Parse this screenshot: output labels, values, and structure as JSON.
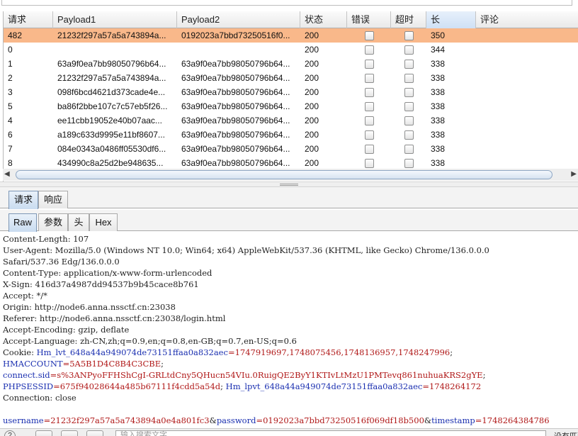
{
  "table": {
    "columns": [
      "请求",
      "Payload1",
      "Payload2",
      "状态",
      "错误",
      "超时",
      "长",
      "评论"
    ],
    "sorted_column": "长",
    "sort_icon": "sort-descending-icon",
    "rows": [
      {
        "req": "482",
        "p1": "21232f297a57a5a743894a...",
        "p2": "0192023a7bbd73250516f0...",
        "status": "200",
        "error": false,
        "timeout": false,
        "length": "350",
        "comment": "",
        "selected": true
      },
      {
        "req": "0",
        "p1": "",
        "p2": "",
        "status": "200",
        "error": false,
        "timeout": false,
        "length": "344",
        "comment": "",
        "selected": false
      },
      {
        "req": "1",
        "p1": "63a9f0ea7bb98050796b64...",
        "p2": "63a9f0ea7bb98050796b64...",
        "status": "200",
        "error": false,
        "timeout": false,
        "length": "338",
        "comment": "",
        "selected": false
      },
      {
        "req": "2",
        "p1": "21232f297a57a5a743894a...",
        "p2": "63a9f0ea7bb98050796b64...",
        "status": "200",
        "error": false,
        "timeout": false,
        "length": "338",
        "comment": "",
        "selected": false
      },
      {
        "req": "3",
        "p1": "098f6bcd4621d373cade4e...",
        "p2": "63a9f0ea7bb98050796b64...",
        "status": "200",
        "error": false,
        "timeout": false,
        "length": "338",
        "comment": "",
        "selected": false
      },
      {
        "req": "5",
        "p1": "ba86f2bbe107c7c57eb5f26...",
        "p2": "63a9f0ea7bb98050796b64...",
        "status": "200",
        "error": false,
        "timeout": false,
        "length": "338",
        "comment": "",
        "selected": false
      },
      {
        "req": "4",
        "p1": "ee11cbb19052e40b07aac...",
        "p2": "63a9f0ea7bb98050796b64...",
        "status": "200",
        "error": false,
        "timeout": false,
        "length": "338",
        "comment": "",
        "selected": false
      },
      {
        "req": "6",
        "p1": "a189c633d9995e11bf8607...",
        "p2": "63a9f0ea7bb98050796b64...",
        "status": "200",
        "error": false,
        "timeout": false,
        "length": "338",
        "comment": "",
        "selected": false
      },
      {
        "req": "7",
        "p1": "084e0343a0486ff05530df6...",
        "p2": "63a9f0ea7bb98050796b64...",
        "status": "200",
        "error": false,
        "timeout": false,
        "length": "338",
        "comment": "",
        "selected": false
      },
      {
        "req": "8",
        "p1": "434990c8a25d2be948635...",
        "p2": "63a9f0ea7bb98050796b64...",
        "status": "200",
        "error": false,
        "timeout": false,
        "length": "338",
        "comment": "",
        "selected": false
      }
    ]
  },
  "main_tabs": {
    "request": "请求",
    "response": "响应",
    "active": "request"
  },
  "sub_tabs": {
    "raw": "Raw",
    "params": "参数",
    "headers": "头",
    "hex": "Hex",
    "active": "raw"
  },
  "raw_request": {
    "lines": [
      [
        {
          "t": "Content-Length: 107",
          "c": "k-dark"
        }
      ],
      [
        {
          "t": "User-Agent: Mozilla/5.0 (Windows NT 10.0; Win64; x64) AppleWebKit/537.36 (KHTML, like Gecko) Chrome/136.0.0.0",
          "c": "k-dark"
        }
      ],
      [
        {
          "t": "Safari/537.36 Edg/136.0.0.0",
          "c": "k-dark"
        }
      ],
      [
        {
          "t": "Content-Type: application/x-www-form-urlencoded",
          "c": "k-dark"
        }
      ],
      [
        {
          "t": "X-Sign: 416d37a4987dd94537b9b45cace8b761",
          "c": "k-dark"
        }
      ],
      [
        {
          "t": "Accept: */*",
          "c": "k-dark"
        }
      ],
      [
        {
          "t": "Origin: http://node6.anna.nssctf.cn:23038",
          "c": "k-dark"
        }
      ],
      [
        {
          "t": "Referer: http://node6.anna.nssctf.cn:23038/login.html",
          "c": "k-dark"
        }
      ],
      [
        {
          "t": "Accept-Encoding: gzip, deflate",
          "c": "k-dark"
        }
      ],
      [
        {
          "t": "Accept-Language: zh-CN,zh;q=0.9,en;q=0.8,en-GB;q=0.7,en-US;q=0.6",
          "c": "k-dark"
        }
      ],
      [
        {
          "t": "Cookie: ",
          "c": "k-dark"
        },
        {
          "t": "Hm_lvt_648a44a949074de73151ffaa0a832aec",
          "c": "k-blue"
        },
        {
          "t": "=1747919697,1748075456,1748136957,1748247996",
          "c": "k-red"
        },
        {
          "t": ";",
          "c": "k-dark"
        }
      ],
      [
        {
          "t": "HMACCOUNT",
          "c": "k-blue"
        },
        {
          "t": "=5A5B1D4C8B4C3CBE",
          "c": "k-red"
        },
        {
          "t": ";",
          "c": "k-dark"
        }
      ],
      [
        {
          "t": "connect.sid",
          "c": "k-blue"
        },
        {
          "t": "=s%3ANPyoFFHShCgI-GRLtdCny5QHucn54VIu.0RuigQE2ByY1KTIvLtMzU1PMTevq861nuhuaKRS2gYE",
          "c": "k-red"
        },
        {
          "t": ";",
          "c": "k-dark"
        }
      ],
      [
        {
          "t": "PHPSESSID",
          "c": "k-blue"
        },
        {
          "t": "=675f94028644a485b67111f4cdd5a54d",
          "c": "k-red"
        },
        {
          "t": "; ",
          "c": "k-dark"
        },
        {
          "t": "Hm_lpvt_648a44a949074de73151ffaa0a832aec",
          "c": "k-blue"
        },
        {
          "t": "=1748264172",
          "c": "k-red"
        }
      ],
      [
        {
          "t": "Connection: close",
          "c": "k-dark"
        }
      ],
      [
        {
          "t": "",
          "c": "k-dark"
        }
      ],
      [
        {
          "t": "username",
          "c": "k-blue"
        },
        {
          "t": "=21232f297a57a5a743894a0e4a801fc3",
          "c": "k-red"
        },
        {
          "t": "&",
          "c": "k-dark"
        },
        {
          "t": "password",
          "c": "k-blue"
        },
        {
          "t": "=0192023a7bbd73250516f069df18b500",
          "c": "k-red"
        },
        {
          "t": "&",
          "c": "k-dark"
        },
        {
          "t": "timestamp",
          "c": "k-blue"
        },
        {
          "t": "=1748264384786",
          "c": "k-red"
        }
      ]
    ]
  },
  "bottom_bar": {
    "help_label": "?",
    "search_placeholder": "输入搜索文字",
    "status": "没有匹配"
  }
}
